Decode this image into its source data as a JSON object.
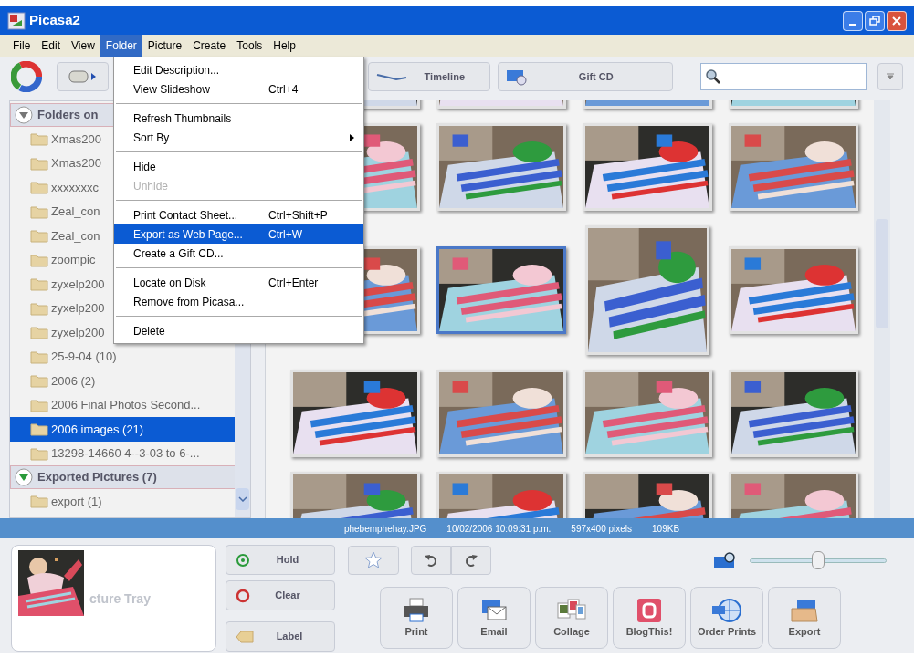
{
  "window": {
    "title": "Picasa2"
  },
  "menu_bar": [
    {
      "label": "File",
      "selected": false
    },
    {
      "label": "Edit",
      "selected": false
    },
    {
      "label": "View",
      "selected": false
    },
    {
      "label": "Folder",
      "selected": true
    },
    {
      "label": "Picture",
      "selected": false
    },
    {
      "label": "Create",
      "selected": false
    },
    {
      "label": "Tools",
      "selected": false
    },
    {
      "label": "Help",
      "selected": false
    }
  ],
  "toolbar": {
    "buttons": [
      {
        "label": "Timeline"
      },
      {
        "label": "Gift CD"
      }
    ]
  },
  "folder_menu": [
    {
      "kind": "item",
      "label": "Edit Description...",
      "disabled": false,
      "selected": false,
      "submenu": false
    },
    {
      "kind": "item",
      "label": "View Slideshow",
      "shortcut": "Ctrl+4",
      "disabled": false,
      "selected": false,
      "submenu": false
    },
    {
      "kind": "separator"
    },
    {
      "kind": "item",
      "label": "Refresh Thumbnails",
      "disabled": false,
      "selected": false,
      "submenu": false
    },
    {
      "kind": "item",
      "label": "Sort By",
      "disabled": false,
      "selected": false,
      "submenu": true
    },
    {
      "kind": "separator"
    },
    {
      "kind": "item",
      "label": "Hide",
      "disabled": false,
      "selected": false,
      "submenu": false
    },
    {
      "kind": "item",
      "label": "Unhide",
      "disabled": true,
      "selected": false,
      "submenu": false
    },
    {
      "kind": "separator"
    },
    {
      "kind": "item",
      "label": "Print Contact Sheet...",
      "shortcut": "Ctrl+Shift+P",
      "disabled": false,
      "selected": false,
      "submenu": false
    },
    {
      "kind": "item",
      "label": "Export as Web Page...",
      "shortcut": "Ctrl+W",
      "disabled": false,
      "selected": true,
      "submenu": false
    },
    {
      "kind": "item",
      "label": "Create a Gift CD...",
      "disabled": false,
      "selected": false,
      "submenu": false
    },
    {
      "kind": "separator"
    },
    {
      "kind": "item",
      "label": "Locate on Disk",
      "shortcut": "Ctrl+Enter",
      "disabled": false,
      "selected": false,
      "submenu": false
    },
    {
      "kind": "item",
      "label": "Remove from Picasa...",
      "disabled": false,
      "selected": false,
      "submenu": false
    },
    {
      "kind": "separator"
    },
    {
      "kind": "item",
      "label": "Delete",
      "disabled": false,
      "selected": false,
      "submenu": false
    }
  ],
  "sidebar": {
    "groups": [
      {
        "title": "Folders on",
        "expanded": true,
        "items": [
          {
            "label": "Xmas200",
            "selected": false
          },
          {
            "label": "Xmas200",
            "selected": false
          },
          {
            "label": "xxxxxxxc",
            "selected": false
          },
          {
            "label": "Zeal_con",
            "selected": false
          },
          {
            "label": "Zeal_con",
            "selected": false
          },
          {
            "label": "zoompic_",
            "selected": false
          },
          {
            "label": "zyxelp200",
            "selected": false
          },
          {
            "label": "zyxelp200",
            "selected": false
          },
          {
            "label": "zyxelp200",
            "selected": false
          },
          {
            "label": "25-9-04 (10)",
            "selected": false
          },
          {
            "label": "2006 (2)",
            "selected": false
          },
          {
            "label": "2006 Final Photos Second...",
            "selected": false
          },
          {
            "label": "2006 images (21)",
            "selected": true
          },
          {
            "label": "13298-14660 4--3-03 to 6-...",
            "selected": false
          }
        ]
      },
      {
        "title": "Exported Pictures (7)",
        "expanded": true,
        "items": [
          {
            "label": "export (1)",
            "selected": false
          }
        ]
      }
    ]
  },
  "thumbnails": [
    {
      "kind": "picture",
      "selected": false
    },
    {
      "kind": "picture",
      "selected": false
    },
    {
      "kind": "picture",
      "selected": false
    },
    {
      "kind": "picture",
      "selected": false
    },
    {
      "kind": "picture",
      "selected": false
    },
    {
      "kind": "picture",
      "selected": false
    },
    {
      "kind": "picture",
      "selected": false
    },
    {
      "kind": "picture",
      "selected": false
    },
    {
      "kind": "picture",
      "selected": false
    },
    {
      "kind": "picture",
      "selected": true
    },
    {
      "kind": "picture",
      "selected": false
    },
    {
      "kind": "picture",
      "selected": false
    },
    {
      "kind": "picture",
      "selected": false
    },
    {
      "kind": "picture",
      "selected": false
    },
    {
      "kind": "picture",
      "selected": false
    },
    {
      "kind": "picture",
      "selected": false
    },
    {
      "kind": "picture",
      "selected": false
    },
    {
      "kind": "picture",
      "selected": false
    },
    {
      "kind": "picture",
      "selected": false
    },
    {
      "kind": "picture",
      "selected": false
    }
  ],
  "status_bar": [
    "phebemphehay.JPG",
    "10/02/2006 10:09:31 p.m.",
    "597x400 pixels",
    "109KB"
  ],
  "picture_tray": {
    "label": "cture Tray",
    "tray_buttons": [
      {
        "label": "Hold",
        "kind": "hold"
      },
      {
        "label": "Clear",
        "kind": "clear"
      },
      {
        "label": "Label",
        "kind": "label"
      }
    ]
  },
  "zoom_slider": {
    "level": 0.5
  },
  "actions": [
    {
      "label": "Print",
      "kind": "print"
    },
    {
      "label": "Email",
      "kind": "email"
    },
    {
      "label": "Collage",
      "kind": "collage"
    },
    {
      "label": "BlogThis!",
      "kind": "blog"
    },
    {
      "label": "Order Prints",
      "kind": "order"
    },
    {
      "label": "Export",
      "kind": "export"
    }
  ]
}
